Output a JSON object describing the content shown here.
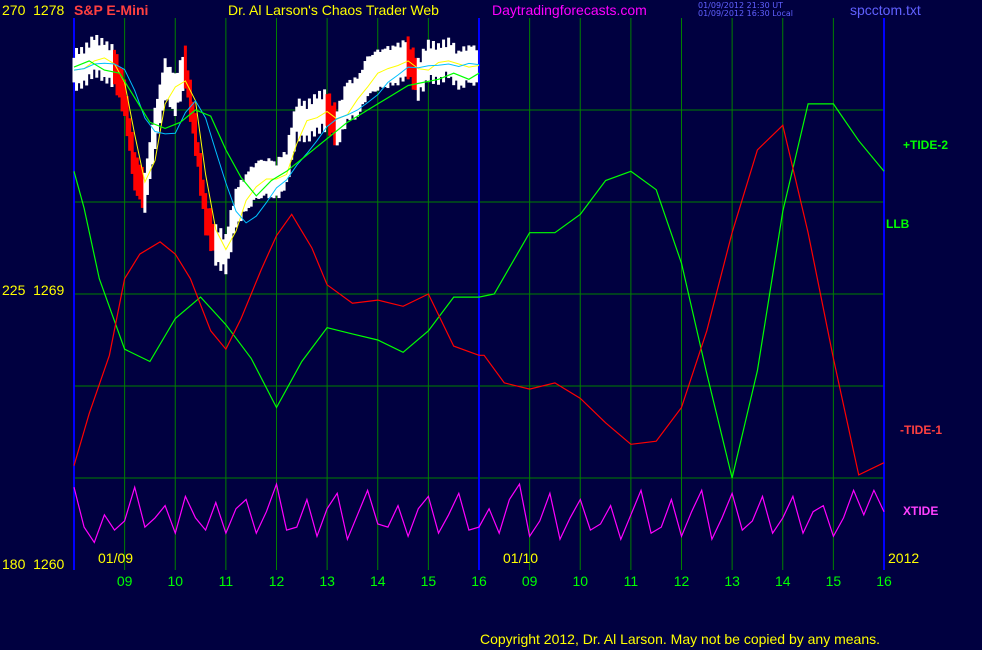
{
  "header": {
    "symbol": "S&P E-Mini",
    "title": "Dr. Al Larson's Chaos Trader Web",
    "site": "Daytradingforecasts.com",
    "ts_utc": "01/09/2012 21:30 UT",
    "ts_local": "01/09/2012 16:30 Local",
    "file": "spcctom.txt"
  },
  "y_axis": {
    "top": {
      "left": "270",
      "right": "1278"
    },
    "mid": {
      "left": "225",
      "right": "1269"
    },
    "bottom": {
      "left": "180",
      "right": "1260"
    }
  },
  "date_labels": {
    "day1": "01/09",
    "day2": "01/10",
    "year": "2012"
  },
  "copyright": "Copyright 2012, Dr. Al Larson. May not be copied by any means.",
  "colors": {
    "bg": "#000040",
    "grid": "#008000",
    "frame": "#0000ff",
    "tide2": "#00ff00",
    "tide1": "#ff0000",
    "xtide": "#ff00ff",
    "price": "#ffffff",
    "price_down": "#ff0000",
    "ma_fast": "#ffff00",
    "ma_slow": "#00c0ff"
  },
  "chart_data": {
    "type": "line",
    "x_ticks": [
      "09",
      "10",
      "11",
      "12",
      "13",
      "14",
      "15",
      "16",
      "09",
      "10",
      "11",
      "12",
      "13",
      "14",
      "15",
      "16"
    ],
    "ylim": [
      1260,
      1278
    ],
    "series": [
      {
        "name": "+TIDE-2",
        "x": [
          8.0,
          8.2,
          8.5,
          9.0,
          9.5,
          10.0,
          10.5,
          11.0,
          11.5,
          12.0,
          12.5,
          13.0,
          13.5,
          14.0,
          14.5,
          15.0,
          15.5,
          16.0,
          16.3,
          17.0,
          17.5,
          18.0,
          18.5,
          19.0,
          19.5,
          20.0,
          20.5,
          21.0,
          21.5,
          22.0,
          22.5,
          23.0,
          23.5,
          24.0
        ],
        "y": [
          1273.0,
          1271.8,
          1269.5,
          1267.2,
          1266.8,
          1268.2,
          1268.9,
          1268.0,
          1266.9,
          1265.3,
          1266.8,
          1267.9,
          1267.7,
          1267.5,
          1267.1,
          1267.8,
          1268.9,
          1268.9,
          1269.0,
          1271.0,
          1271.0,
          1271.6,
          1272.7,
          1273.0,
          1272.4,
          1270.0,
          1266.4,
          1263.0,
          1266.5,
          1271.7,
          1275.2,
          1275.2,
          1274.0,
          1273.0
        ]
      },
      {
        "name": "-TIDE-1",
        "x": [
          8.0,
          8.3,
          8.7,
          9.0,
          9.3,
          9.7,
          10.0,
          10.3,
          10.7,
          11.0,
          11.3,
          11.7,
          12.0,
          12.3,
          12.7,
          13.0,
          13.5,
          14.0,
          14.5,
          15.0,
          15.5,
          16.0,
          16.1,
          16.5,
          17.0,
          17.5,
          18.0,
          18.5,
          19.0,
          19.5,
          20.0,
          20.5,
          21.0,
          21.5,
          22.0,
          22.5,
          23.0,
          23.5,
          24.0
        ],
        "y": [
          1263.4,
          1265.1,
          1267.0,
          1269.5,
          1270.3,
          1270.7,
          1270.3,
          1269.5,
          1267.8,
          1267.2,
          1268.2,
          1269.8,
          1270.9,
          1271.6,
          1270.5,
          1269.3,
          1268.7,
          1268.8,
          1268.6,
          1269.0,
          1267.3,
          1267.0,
          1267.0,
          1266.1,
          1265.9,
          1266.1,
          1265.6,
          1264.8,
          1264.1,
          1264.2,
          1265.3,
          1267.8,
          1271.0,
          1273.7,
          1274.5,
          1271.0,
          1266.9,
          1263.1,
          1263.5
        ]
      },
      {
        "name": "XTIDE",
        "x": [
          8.0,
          8.2,
          8.4,
          8.6,
          8.8,
          9.0,
          9.2,
          9.4,
          9.6,
          9.8,
          10.0,
          10.2,
          10.4,
          10.6,
          10.8,
          11.0,
          11.2,
          11.4,
          11.6,
          11.8,
          12.0,
          12.2,
          12.4,
          12.6,
          12.8,
          13.0,
          13.2,
          13.4,
          13.6,
          13.8,
          14.0,
          14.2,
          14.4,
          14.6,
          14.8,
          15.0,
          15.2,
          15.4,
          15.6,
          15.8,
          16.0,
          16.2,
          16.4,
          16.6,
          16.8,
          17.0,
          17.2,
          17.4,
          17.6,
          17.8,
          18.0,
          18.2,
          18.4,
          18.6,
          18.8,
          19.0,
          19.2,
          19.4,
          19.6,
          19.8,
          20.0,
          20.2,
          20.4,
          20.6,
          20.8,
          21.0,
          21.2,
          21.4,
          21.6,
          21.8,
          22.0,
          22.2,
          22.4,
          22.6,
          22.8,
          23.0,
          23.2,
          23.4,
          23.6,
          23.8,
          24.0
        ],
        "y": [
          1262.7,
          1261.4,
          1260.9,
          1261.8,
          1261.3,
          1261.6,
          1262.7,
          1261.4,
          1261.7,
          1262.1,
          1261.2,
          1262.4,
          1261.7,
          1261.3,
          1262.2,
          1261.2,
          1262.0,
          1262.3,
          1261.2,
          1261.9,
          1262.8,
          1261.3,
          1261.4,
          1262.3,
          1261.1,
          1262.0,
          1262.5,
          1261.0,
          1261.8,
          1262.6,
          1261.5,
          1261.4,
          1262.1,
          1261.1,
          1262.0,
          1262.4,
          1261.2,
          1261.8,
          1262.5,
          1261.3,
          1261.4,
          1262.0,
          1261.2,
          1262.3,
          1262.8,
          1261.1,
          1261.6,
          1262.5,
          1261.0,
          1261.7,
          1262.3,
          1261.3,
          1261.5,
          1262.1,
          1261.0,
          1261.8,
          1262.6,
          1261.2,
          1261.4,
          1262.3,
          1261.1,
          1261.9,
          1262.6,
          1261.0,
          1261.7,
          1262.5,
          1261.3,
          1261.6,
          1262.4,
          1261.2,
          1261.7,
          1262.4,
          1261.2,
          1261.9,
          1262.1,
          1261.1,
          1261.7,
          1262.6,
          1261.8,
          1262.6,
          1261.9
        ]
      },
      {
        "name": "LLB",
        "x": [
          8.0,
          8.3,
          8.6,
          8.9,
          9.2,
          9.5,
          9.8,
          10.1,
          10.4,
          10.7,
          11.0,
          11.3,
          11.6,
          11.9,
          12.2,
          12.5,
          12.8,
          13.1,
          13.4,
          13.7,
          14.0,
          14.3,
          14.6,
          14.9,
          15.2,
          15.5,
          15.8,
          16.0
        ],
        "y": [
          1276.4,
          1276.6,
          1276.3,
          1276.2,
          1275.4,
          1274.6,
          1274.4,
          1274.6,
          1275.0,
          1274.8,
          1273.7,
          1272.8,
          1272.2,
          1272.7,
          1273.0,
          1273.4,
          1273.8,
          1274.2,
          1274.6,
          1274.9,
          1275.2,
          1275.5,
          1275.8,
          1275.9,
          1276.0,
          1276.2,
          1276.0,
          1276.2
        ]
      },
      {
        "name": "price_close",
        "x": [
          8.0,
          8.2,
          8.4,
          8.6,
          8.8,
          9.0,
          9.2,
          9.4,
          9.6,
          9.8,
          10.0,
          10.2,
          10.4,
          10.6,
          10.8,
          11.0,
          11.2,
          11.4,
          11.6,
          11.8,
          12.0,
          12.2,
          12.4,
          12.6,
          12.8,
          13.0,
          13.2,
          13.4,
          13.6,
          13.8,
          14.0,
          14.2,
          14.4,
          14.6,
          14.8,
          15.0,
          15.2,
          15.4,
          15.6,
          15.8,
          16.0
        ],
        "y": [
          1276.3,
          1276.4,
          1276.8,
          1276.6,
          1276.4,
          1275.4,
          1273.0,
          1272.3,
          1274.4,
          1276.0,
          1275.5,
          1276.4,
          1274.2,
          1271.6,
          1270.6,
          1270.3,
          1271.8,
          1272.3,
          1272.7,
          1272.8,
          1272.7,
          1273.1,
          1274.7,
          1274.6,
          1274.9,
          1275.0,
          1274.4,
          1275.3,
          1275.4,
          1276.1,
          1276.3,
          1276.4,
          1276.5,
          1276.7,
          1276.0,
          1276.6,
          1276.5,
          1276.7,
          1276.3,
          1276.5,
          1276.4
        ]
      }
    ]
  }
}
